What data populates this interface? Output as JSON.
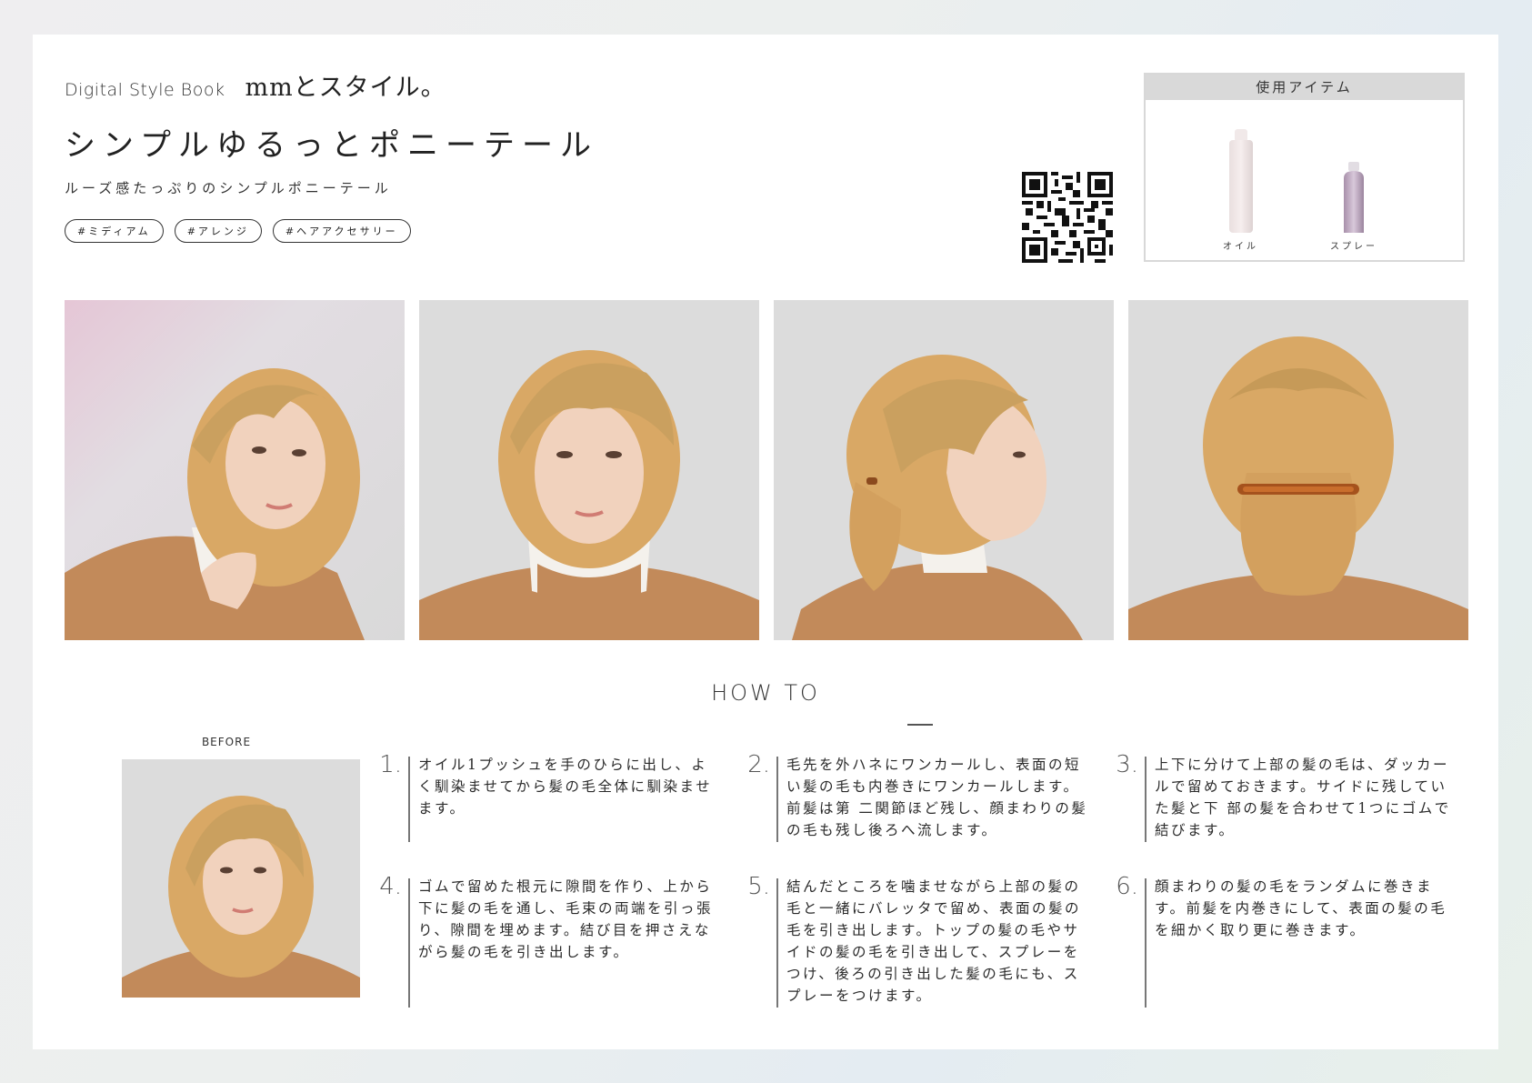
{
  "header": {
    "brand_sub": "Digital Style Book",
    "brand_main": "mmとスタイル。",
    "title": "シンプルゆるっとポニーテール",
    "subtitle": "ルーズ感たっぷりのシンプルポニーテール",
    "tags": [
      "#ミディアム",
      "#アレンジ",
      "#ヘアアクセサリー"
    ]
  },
  "items_box": {
    "heading": "使用アイテム",
    "items": [
      {
        "label": "オイル",
        "icon": "oil-bottle-icon"
      },
      {
        "label": "スプレー",
        "icon": "spray-can-icon"
      }
    ]
  },
  "qr": {
    "icon": "qr-code-icon"
  },
  "howto": {
    "heading": "HOW TO",
    "before_label": "BEFORE",
    "steps": [
      {
        "num": "1.",
        "text": "オイル1プッシュを手のひらに出し、よく馴染ませてから髪の毛全体に馴染ませます。"
      },
      {
        "num": "2.",
        "text": "毛先を外ハネにワンカールし、表面の短い髪の毛も内巻きにワンカールします。前髪は第 二関節ほど残し、顔まわりの髪の毛も残し後ろへ流します。"
      },
      {
        "num": "3.",
        "text": "上下に分けて上部の髪の毛は、ダッカールで留めておきます。サイドに残していた髪と下 部の髪を合わせて1つにゴムで結びます。"
      },
      {
        "num": "4.",
        "text": "ゴムで留めた根元に隙間を作り、上から下に髪の毛を通し、毛束の両端を引っ張り、隙間を埋めます。結び目を押さえながら髪の毛を引き出します。"
      },
      {
        "num": "5.",
        "text": "結んだところを噛ませながら上部の髪の毛と一緒にバレッタで留め、表面の髪の毛を引き出します。トップの髪の毛やサイドの髪の毛を引き出して、スプレーをつけ、後ろの引き出した髪の毛にも、スプレーをつけます。"
      },
      {
        "num": "6.",
        "text": "顔まわりの髪の毛をランダムに巻きます。前髪を内巻きにして、表面の髪の毛を細かく取り更に巻きます。"
      }
    ]
  },
  "colors": {
    "hair": "#d9a865",
    "sweater": "#c28a5a",
    "skin": "#f1d2bd",
    "background_photo": "#dcdcdc"
  }
}
